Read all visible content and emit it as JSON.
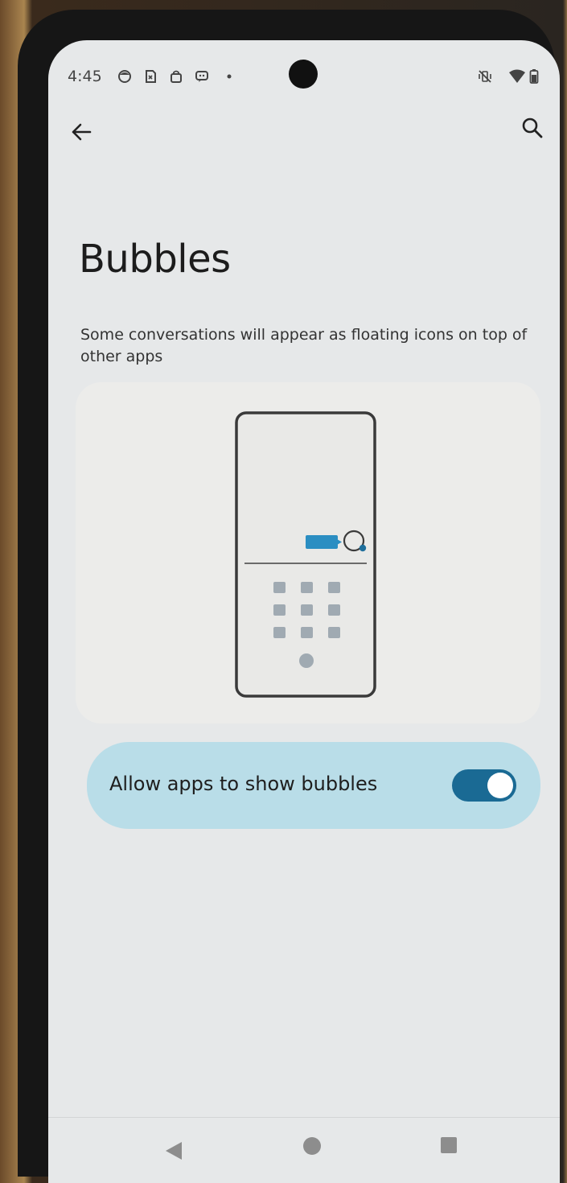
{
  "status_bar": {
    "time": "4:45",
    "left_icons": [
      "face-notification-icon",
      "sim-notification-icon",
      "bag-notification-icon",
      "message-notification-icon",
      "more-notifications-dot-icon"
    ],
    "right_icons": [
      "vibrate-off-icon",
      "wifi-icon",
      "battery-icon"
    ]
  },
  "toolbar": {
    "back_icon": "arrow-left-icon",
    "search_icon": "search-icon"
  },
  "page": {
    "title": "Bubbles",
    "description": "Some conversations will appear as floating icons on top of other apps"
  },
  "setting": {
    "label": "Allow apps to show bubbles",
    "enabled": true
  },
  "nav_bar": {
    "icons": [
      "nav-back-icon",
      "nav-home-icon",
      "nav-recents-icon"
    ]
  },
  "colors": {
    "background": "#e6e8e9",
    "accent": "#1a6a94",
    "toggle_card": "#b9dde8",
    "illustration_bubble": "#2b8ec2"
  }
}
